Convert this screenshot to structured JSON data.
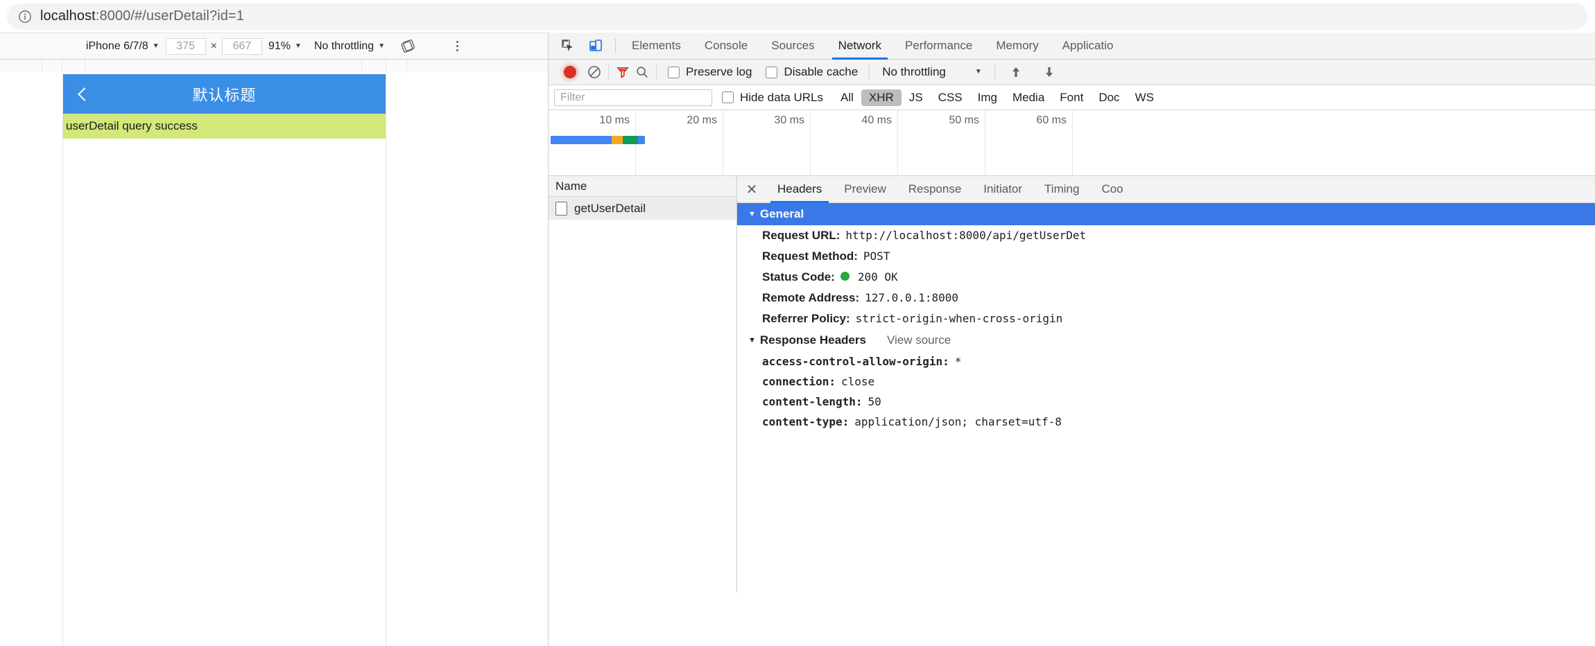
{
  "browser": {
    "info_icon": "info-circle-icon",
    "url_prefix": "localhost",
    "url_suffix": ":8000/#/userDetail?id=1"
  },
  "device_toolbar": {
    "device": "iPhone 6/7/8",
    "width": "375",
    "height": "667",
    "times": "×",
    "zoom": "91%",
    "throttling": "No throttling",
    "rotate_icon": "rotate-device-icon",
    "menu_icon": "kebab-menu-icon",
    "caret": "▼"
  },
  "page": {
    "header_title": "默认标题",
    "back_icon": "back-chevron-icon",
    "banner_text": "userDetail query success",
    "header_color": "#3a8ee6",
    "banner_color": "#d3e87a"
  },
  "devtools": {
    "inspect_icon": "inspect-element-icon",
    "device_toggle_icon": "device-toolbar-icon",
    "tabs": [
      {
        "label": "Elements",
        "active": false
      },
      {
        "label": "Console",
        "active": false
      },
      {
        "label": "Sources",
        "active": false
      },
      {
        "label": "Network",
        "active": true
      },
      {
        "label": "Performance",
        "active": false
      },
      {
        "label": "Memory",
        "active": false
      },
      {
        "label": "Applicatio",
        "active": false
      }
    ],
    "network_toolbar": {
      "record_icon": "record-button",
      "clear_icon": "clear-icon",
      "filter_icon": "filter-funnel-icon",
      "search_icon": "search-icon",
      "preserve_log": "Preserve log",
      "disable_cache": "Disable cache",
      "throttling": "No throttling",
      "caret": "▼",
      "import_icon": "import-har-icon",
      "export_icon": "export-har-icon"
    },
    "filter_row": {
      "filter_placeholder": "Filter",
      "hide_data_urls": "Hide data URLs",
      "types": [
        {
          "label": "All",
          "active": false
        },
        {
          "label": "XHR",
          "active": true
        },
        {
          "label": "JS",
          "active": false
        },
        {
          "label": "CSS",
          "active": false
        },
        {
          "label": "Img",
          "active": false
        },
        {
          "label": "Media",
          "active": false
        },
        {
          "label": "Font",
          "active": false
        },
        {
          "label": "Doc",
          "active": false
        },
        {
          "label": "WS",
          "active": false
        }
      ]
    },
    "timeline": {
      "ticks": [
        "10 ms",
        "20 ms",
        "30 ms",
        "40 ms",
        "50 ms",
        "60 ms"
      ],
      "bar_segments": [
        {
          "color": "#4285f4",
          "width": 88
        },
        {
          "color": "#f5a623",
          "width": 16
        },
        {
          "color": "#0f9d58",
          "width": 22
        },
        {
          "color": "#4285f4",
          "width": 10
        }
      ]
    },
    "request_list": {
      "column_header": "Name",
      "rows": [
        {
          "name": "getUserDetail",
          "icon": "document-icon"
        }
      ]
    },
    "detail_panel": {
      "close_icon": "close-icon",
      "tabs": [
        {
          "label": "Headers",
          "active": true
        },
        {
          "label": "Preview",
          "active": false
        },
        {
          "label": "Response",
          "active": false
        },
        {
          "label": "Initiator",
          "active": false
        },
        {
          "label": "Timing",
          "active": false
        },
        {
          "label": "Coo",
          "active": false
        }
      ],
      "general": {
        "title": "General",
        "rows": [
          {
            "key": "Request URL:",
            "value": "http://localhost:8000/api/getUserDet"
          },
          {
            "key": "Request Method:",
            "value": "POST"
          },
          {
            "key": "Status Code:",
            "value": "200 OK",
            "status_dot": "#2aa83f"
          },
          {
            "key": "Remote Address:",
            "value": "127.0.0.1:8000"
          },
          {
            "key": "Referrer Policy:",
            "value": "strict-origin-when-cross-origin"
          }
        ]
      },
      "response_headers": {
        "title": "Response Headers",
        "view_source": "View source",
        "rows": [
          {
            "key": "access-control-allow-origin:",
            "value": "*"
          },
          {
            "key": "connection:",
            "value": "close"
          },
          {
            "key": "content-length:",
            "value": "50"
          },
          {
            "key": "content-type:",
            "value": "application/json; charset=utf-8"
          }
        ]
      }
    }
  }
}
